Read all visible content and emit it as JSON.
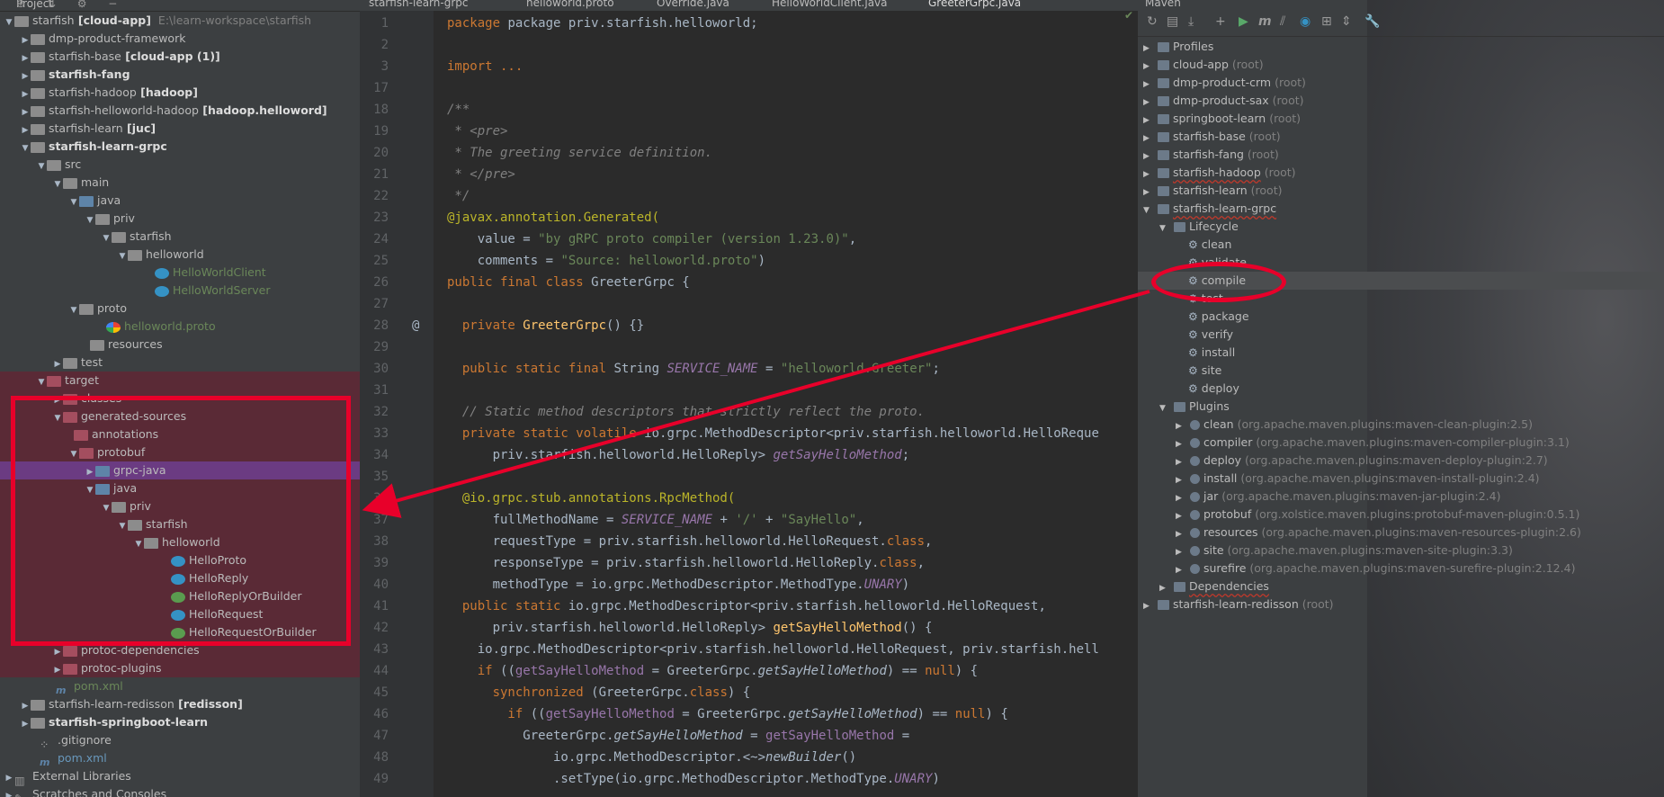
{
  "project_panel": {
    "title": "Project",
    "rows": [
      {
        "text": "starfish",
        "suffix": " [cloud-app]",
        "extra": "E:\\learn-workspace\\starfish"
      },
      {
        "text": "dmp-product-framework"
      },
      {
        "text": "starfish-base",
        "suffix": " [cloud-app (1)]"
      },
      {
        "text": "starfish-fang"
      },
      {
        "text": "starfish-hadoop",
        "suffix": " [hadoop]"
      },
      {
        "text": "starfish-helloworld-hadoop",
        "suffix": " [hadoop.helloword]"
      },
      {
        "text": "starfish-learn",
        "suffix": " [juc]"
      },
      {
        "text": "starfish-learn-grpc"
      },
      {
        "text": "src"
      },
      {
        "text": "main"
      },
      {
        "text": "java"
      },
      {
        "text": "priv"
      },
      {
        "text": "starfish"
      },
      {
        "text": "helloworld"
      },
      {
        "text": "HelloWorldClient"
      },
      {
        "text": "HelloWorldServer"
      },
      {
        "text": "proto"
      },
      {
        "text": "helloworld.proto"
      },
      {
        "text": "resources"
      },
      {
        "text": "test"
      },
      {
        "text": "target"
      },
      {
        "text": "classes"
      },
      {
        "text": "generated-sources"
      },
      {
        "text": "annotations"
      },
      {
        "text": "protobuf"
      },
      {
        "text": "grpc-java"
      },
      {
        "text": "java"
      },
      {
        "text": "priv"
      },
      {
        "text": "starfish"
      },
      {
        "text": "helloworld"
      },
      {
        "text": "HelloProto"
      },
      {
        "text": "HelloReply"
      },
      {
        "text": "HelloReplyOrBuilder"
      },
      {
        "text": "HelloRequest"
      },
      {
        "text": "HelloRequestOrBuilder"
      },
      {
        "text": "protoc-dependencies"
      },
      {
        "text": "protoc-plugins"
      },
      {
        "text": "pom.xml"
      },
      {
        "text": "starfish-learn-redisson",
        "suffix": " [redisson]"
      },
      {
        "text": "starfish-springboot-learn"
      },
      {
        "text": ".gitignore"
      },
      {
        "text": "pom.xml"
      },
      {
        "text": "External Libraries"
      },
      {
        "text": "Scratches and Consoles"
      }
    ]
  },
  "editor": {
    "tabs": [
      "starfish-learn-grpc",
      "helloworld.proto",
      "Override.java",
      "HelloWorldClient.java",
      "GreeterGrpc.java"
    ],
    "line_numbers": [
      "1",
      "2",
      "3",
      "17",
      "18",
      "19",
      "20",
      "21",
      "22",
      "23",
      "24",
      "25",
      "26",
      "27",
      "28",
      "29",
      "30",
      "31",
      "32",
      "33",
      "34",
      "35",
      "36",
      "37",
      "38",
      "39",
      "40",
      "41",
      "42",
      "43",
      "44",
      "45",
      "46",
      "47",
      "48",
      "49"
    ],
    "texts": {
      "l1": "package priv.starfish.helloworld;",
      "l3": "import ...",
      "l18": "/**",
      "l19": " * <pre>",
      "l20": " * The greeting service definition.",
      "l21": " * </pre>",
      "l22": " */",
      "l23a": "@javax.annotation.Generated(",
      "l24a": "    value = ",
      "l24b": "\"by gRPC proto compiler (version 1.23.0)\"",
      "l24c": ",",
      "l25a": "    comments = ",
      "l25b": "\"Source: helloworld.proto\"",
      "l25c": ")",
      "l26a": "public final class ",
      "l26b": "GreeterGrpc {",
      "l28a": "  private ",
      "l28b": "GreeterGrpc",
      "l28c": "() {}",
      "l30a": "  public static final ",
      "l30b": "String ",
      "l30c": "SERVICE_NAME",
      "l30d": " = ",
      "l30e": "\"helloworld.Greeter\"",
      "l30f": ";",
      "l32": "  // Static method descriptors that strictly reflect the proto.",
      "l33a": "  private static volatile ",
      "l33b": "io.grpc.MethodDescriptor<priv.starfish.helloworld.HelloReque",
      "l34a": "      priv.starfish.helloworld.HelloReply> ",
      "l34b": "getSayHelloMethod",
      "l34c": ";",
      "l36": "  @io.grpc.stub.annotations.RpcMethod(",
      "l37a": "      fullMethodName = ",
      "l37b": "SERVICE_NAME",
      "l37c": " + ",
      "l37d": "'/'",
      "l37e": " + ",
      "l37f": "\"SayHello\"",
      "l37g": ",",
      "l38a": "      requestType = priv.starfish.helloworld.HelloRequest.",
      "l38b": "class",
      "l38c": ",",
      "l39a": "      responseType = priv.starfish.helloworld.HelloReply.",
      "l39b": "class",
      "l39c": ",",
      "l40a": "      methodType = io.grpc.MethodDescriptor.MethodType.",
      "l40b": "UNARY",
      "l40c": ")",
      "l41a": "  public static ",
      "l41b": "io.grpc.MethodDescriptor<priv.starfish.helloworld.HelloRequest,",
      "l42a": "      priv.starfish.helloworld.HelloReply> ",
      "l42b": "getSayHelloMethod",
      "l42c": "() {",
      "l43": "    io.grpc.MethodDescriptor<priv.starfish.helloworld.HelloRequest, priv.starfish.hell",
      "l44a": "    if ",
      "l44b": "((",
      "l44c": "getSayHelloMethod",
      "l44d": " = GreeterGrpc.",
      "l44e": "getSayHelloMethod",
      "l44f": ") == ",
      "l44g": "null",
      "l44h": ") {",
      "l45a": "      synchronized ",
      "l45b": "(GreeterGrpc.",
      "l45c": "class",
      "l45d": ") {",
      "l46a": "        if ",
      "l46b": "((",
      "l46c": "getSayHelloMethod",
      "l46d": " = GreeterGrpc.",
      "l46e": "getSayHelloMethod",
      "l46f": ") == ",
      "l46g": "null",
      "l46h": ") {",
      "l47a": "          GreeterGrpc.",
      "l47b": "getSayHelloMethod",
      "l47c": " = ",
      "l47d": "getSayHelloMethod",
      "l47e": " =",
      "l48a": "              io.grpc.MethodDescriptor.<~>",
      "l48b": "newBuilder",
      "l48c": "()",
      "l49a": "              .setType(io.grpc.MethodDescriptor.MethodType.",
      "l49b": "UNARY",
      "l49c": ")"
    },
    "at_marker": "@"
  },
  "maven": {
    "title": "Maven",
    "rows": [
      {
        "text": "Profiles"
      },
      {
        "text": "cloud-app",
        "suffix": " (root)"
      },
      {
        "text": "dmp-product-crm",
        "suffix": " (root)"
      },
      {
        "text": "dmp-product-sax",
        "suffix": " (root)"
      },
      {
        "text": "springboot-learn",
        "suffix": " (root)"
      },
      {
        "text": "starfish-base",
        "suffix": " (root)"
      },
      {
        "text": "starfish-fang",
        "suffix": " (root)"
      },
      {
        "text": "starfish-hadoop",
        "suffix": " (root)"
      },
      {
        "text": "starfish-learn",
        "suffix": " (root)"
      },
      {
        "text": "starfish-learn-grpc"
      },
      {
        "text": "Lifecycle"
      },
      {
        "text": "clean"
      },
      {
        "text": "validate"
      },
      {
        "text": "compile"
      },
      {
        "text": "test"
      },
      {
        "text": "package"
      },
      {
        "text": "verify"
      },
      {
        "text": "install"
      },
      {
        "text": "site"
      },
      {
        "text": "deploy"
      },
      {
        "text": "Plugins"
      },
      {
        "text": "clean",
        "suffix": " (org.apache.maven.plugins:maven-clean-plugin:2.5)"
      },
      {
        "text": "compiler",
        "suffix": " (org.apache.maven.plugins:maven-compiler-plugin:3.1)"
      },
      {
        "text": "deploy",
        "suffix": " (org.apache.maven.plugins:maven-deploy-plugin:2.7)"
      },
      {
        "text": "install",
        "suffix": " (org.apache.maven.plugins:maven-install-plugin:2.4)"
      },
      {
        "text": "jar",
        "suffix": " (org.apache.maven.plugins:maven-jar-plugin:2.4)"
      },
      {
        "text": "protobuf",
        "suffix": " (org.xolstice.maven.plugins:protobuf-maven-plugin:0.5.1)"
      },
      {
        "text": "resources",
        "suffix": " (org.apache.maven.plugins:maven-resources-plugin:2.6)"
      },
      {
        "text": "site",
        "suffix": " (org.apache.maven.plugins:maven-site-plugin:3.3)"
      },
      {
        "text": "surefire",
        "suffix": " (org.apache.maven.plugins:maven-surefire-plugin:2.12.4)"
      },
      {
        "text": "Dependencies"
      },
      {
        "text": "starfish-learn-redisson",
        "suffix": " (root)"
      }
    ]
  },
  "colors": {
    "highlight_red": "#e8002a",
    "selection_purple": "#6b3b82",
    "target_bg": "#5a2a36"
  }
}
